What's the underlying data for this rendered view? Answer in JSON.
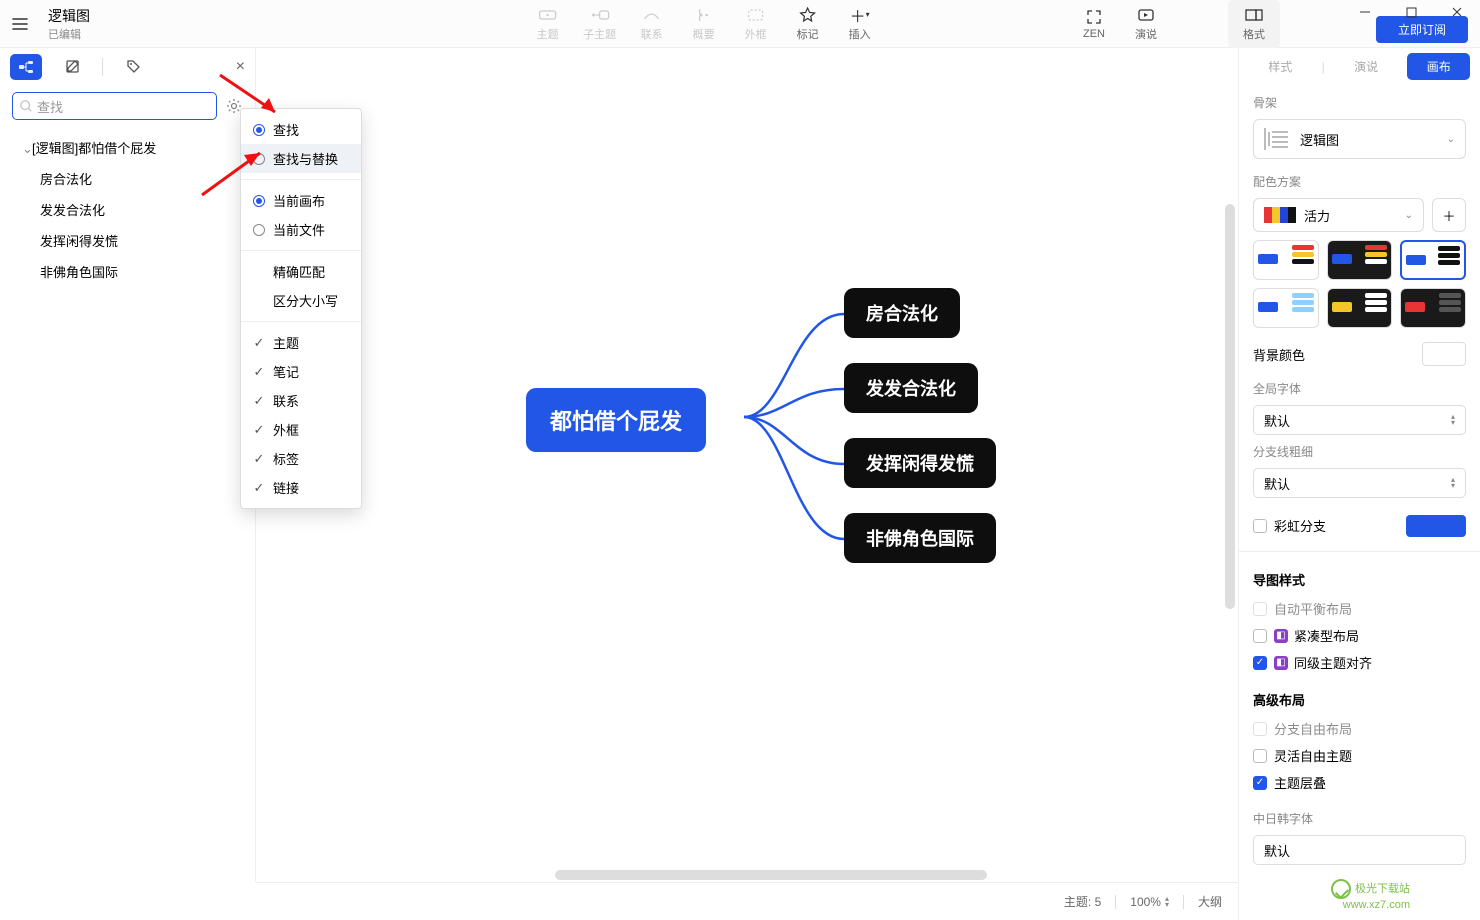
{
  "titlebar": {
    "doc_name": "逻辑图",
    "status": "已编辑"
  },
  "toolbar": {
    "theme": "主题",
    "subtheme": "子主题",
    "relation": "联系",
    "summary": "概要",
    "border": "外框",
    "marker": "标记",
    "insert": "插入",
    "zen": "ZEN",
    "present": "演说",
    "format": "格式"
  },
  "subscribe": "立即订阅",
  "search": {
    "placeholder": "查找"
  },
  "outline": {
    "root": "[逻辑图]都怕借个屁发",
    "items": [
      "房合法化",
      "发发合法化",
      "发挥闲得发慌",
      "非佛角色国际"
    ]
  },
  "popup": {
    "find": "查找",
    "find_replace": "查找与替换",
    "current_canvas": "当前画布",
    "current_file": "当前文件",
    "exact": "精确匹配",
    "case": "区分大小写",
    "theme": "主题",
    "note": "笔记",
    "relation": "联系",
    "border": "外框",
    "label": "标签",
    "link": "链接"
  },
  "mindmap": {
    "center": "都怕借个屁发",
    "nodes": [
      "房合法化",
      "发发合法化",
      "发挥闲得发慌",
      "非佛角色国际"
    ]
  },
  "footer": {
    "topic_label": "主题:",
    "topic_count": "5",
    "zoom": "100%",
    "outline": "大纲"
  },
  "right": {
    "tab_style": "样式",
    "tab_present": "演说",
    "tab_canvas": "画布",
    "skeleton": "骨架",
    "skeleton_value": "逻辑图",
    "scheme": "配色方案",
    "scheme_value": "活力",
    "bg": "背景颜色",
    "global_font": "全局字体",
    "font_value": "默认",
    "branch_w": "分支线粗细",
    "branch_value": "默认",
    "rainbow": "彩虹分支",
    "map_style": "导图样式",
    "auto_balance": "自动平衡布局",
    "compact": "紧凑型布局",
    "align": "同级主题对齐",
    "adv": "高级布局",
    "free_branch": "分支自由布局",
    "free_theme": "灵活自由主题",
    "overlap": "主题层叠",
    "cjk": "中日韩字体",
    "cjk_value": "默认"
  },
  "watermark": {
    "l1": "极光下载站",
    "l2": "www.xz7.com"
  }
}
